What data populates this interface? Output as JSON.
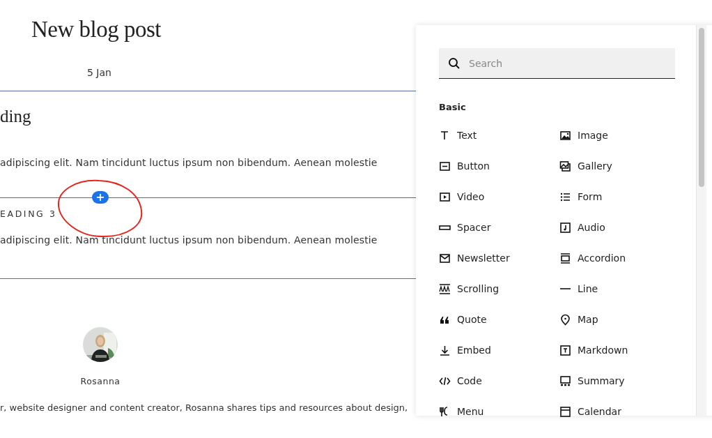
{
  "post": {
    "title": "New blog post",
    "date": "5 Jan",
    "sections": [
      {
        "heading": "ding",
        "kind": "serif",
        "body": "adipiscing elit. Nam tincidunt luctus ipsum non bibendum. Aenean molestie",
        "insert_point": true
      },
      {
        "heading": "EADING 3",
        "kind": "caps",
        "body": "adipiscing elit. Nam tincidunt luctus ipsum non bibendum. Aenean molestie",
        "insert_point": false
      }
    ],
    "insert_button": "+",
    "author": {
      "name": "Rosanna",
      "bio": "r, website designer and content creator, Rosanna shares tips and resources about design,"
    }
  },
  "block_panel": {
    "search": {
      "placeholder": "Search"
    },
    "category": "Basic",
    "blocks": [
      {
        "label": "Text"
      },
      {
        "label": "Image"
      },
      {
        "label": "Button"
      },
      {
        "label": "Gallery"
      },
      {
        "label": "Video"
      },
      {
        "label": "Form"
      },
      {
        "label": "Spacer"
      },
      {
        "label": "Audio"
      },
      {
        "label": "Newsletter"
      },
      {
        "label": "Accordion"
      },
      {
        "label": "Scrolling"
      },
      {
        "label": "Line"
      },
      {
        "label": "Quote"
      },
      {
        "label": "Map"
      },
      {
        "label": "Embed"
      },
      {
        "label": "Markdown"
      },
      {
        "label": "Code"
      },
      {
        "label": "Summary"
      },
      {
        "label": "Menu"
      },
      {
        "label": "Calendar"
      }
    ]
  }
}
